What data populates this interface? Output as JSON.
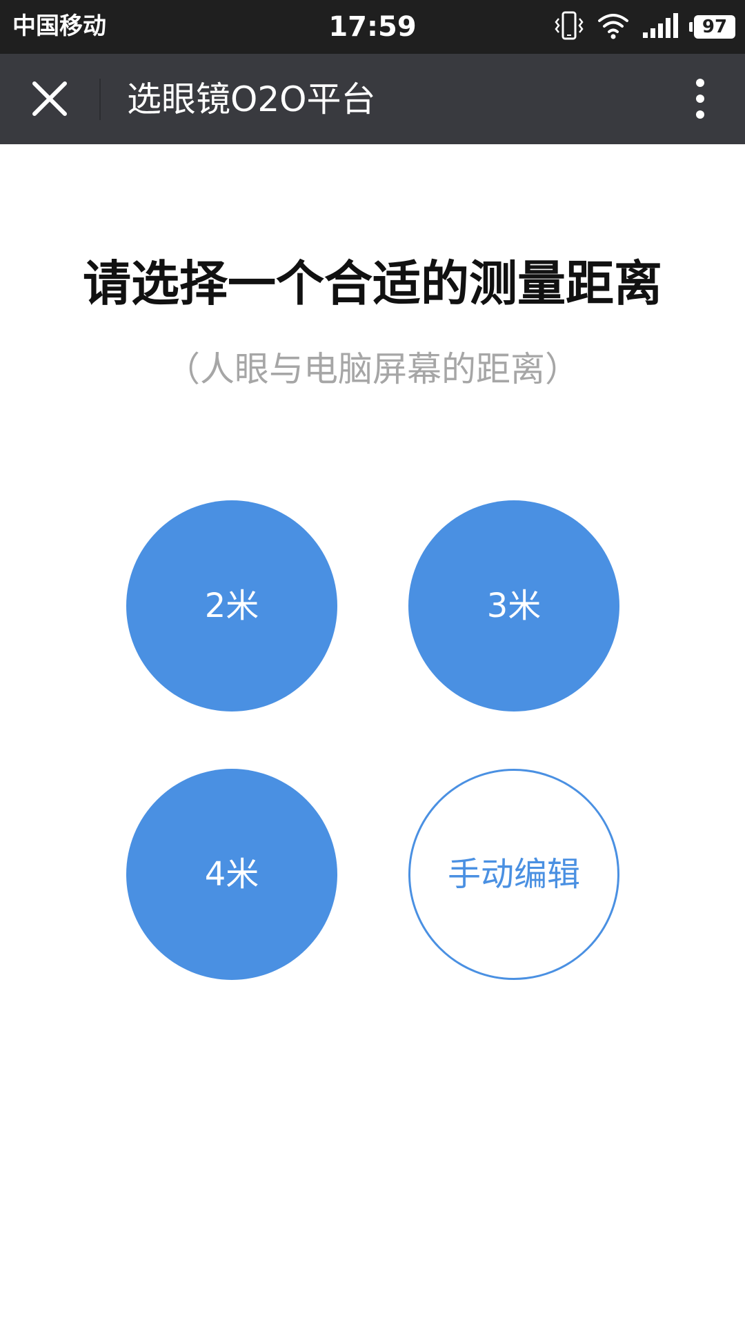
{
  "status_bar": {
    "carrier": "中国移动",
    "time": "17:59",
    "battery_level": "97",
    "icons": [
      "vibrate-icon",
      "wifi-icon",
      "signal-icon",
      "battery-icon"
    ]
  },
  "nav": {
    "title": "选眼镜O2O平台",
    "close_icon": "close-icon",
    "more_icon": "more-vertical-icon"
  },
  "content": {
    "heading": "请选择一个合适的测量距离",
    "subheading": "（人眼与电脑屏幕的距离）",
    "options": [
      {
        "label": "2米",
        "style": "filled"
      },
      {
        "label": "3米",
        "style": "filled"
      },
      {
        "label": "4米",
        "style": "filled"
      },
      {
        "label": "手动编辑",
        "style": "outline"
      }
    ]
  },
  "colors": {
    "status_bar_bg": "#1f1f1f",
    "nav_bar_bg": "#393a3f",
    "accent": "#4a90e2",
    "subheading_text": "#a6a6a6"
  }
}
